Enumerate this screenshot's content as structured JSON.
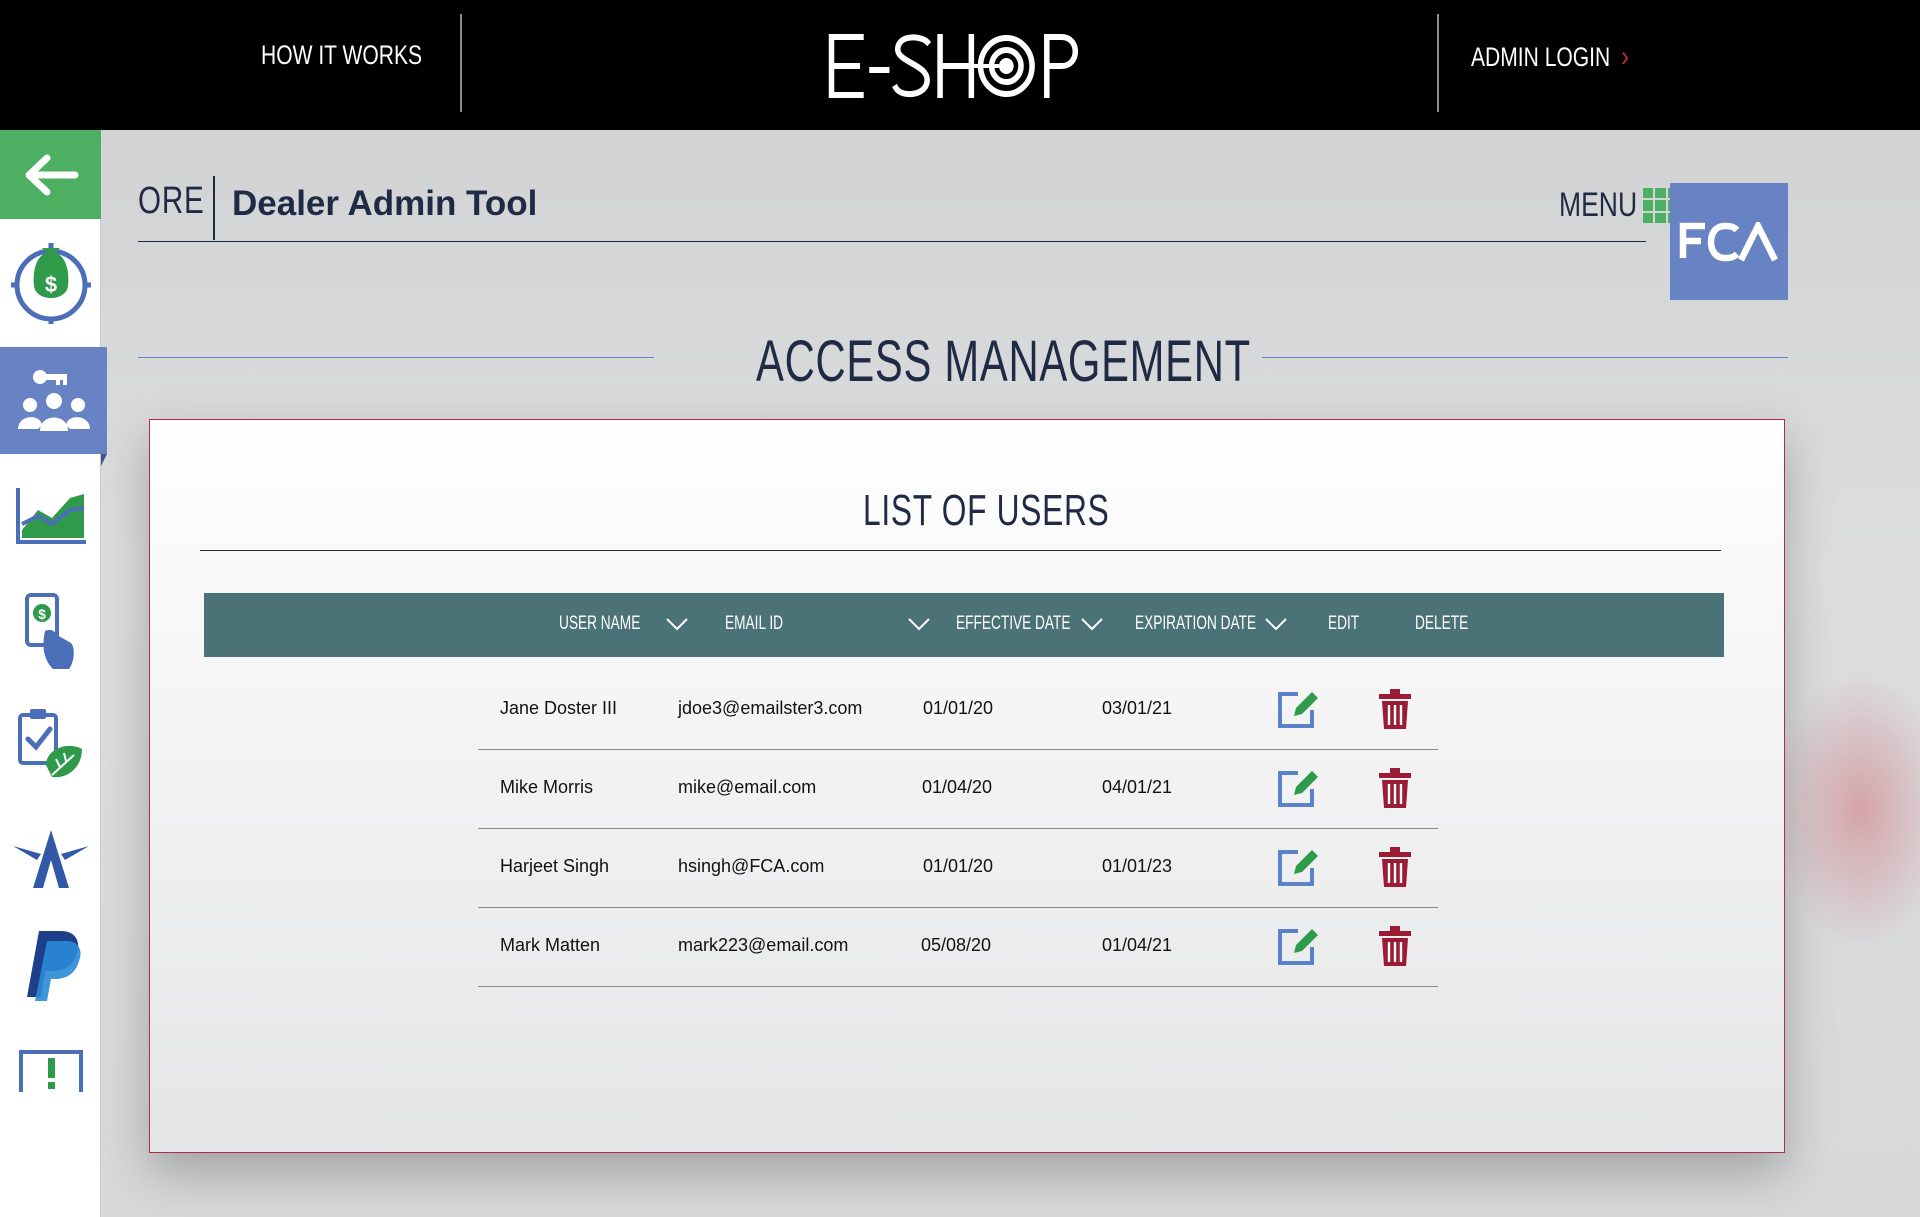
{
  "topbar": {
    "how_it_works": "HOW IT WORKS",
    "logo_text": "E-SHOP",
    "admin_login": "ADMIN LOGIN",
    "admin_chevron": "›"
  },
  "header": {
    "ore": "ORE",
    "title": "Dealer Admin Tool",
    "menu_label": "MENU",
    "brand_logo": "FCA"
  },
  "page_title": "ACCESS MANAGEMENT",
  "card": {
    "title": "LIST OF USERS",
    "columns": [
      "USER NAME",
      "EMAIL ID",
      "EFFECTIVE DATE",
      "EXPIRATION DATE",
      "EDIT",
      "DELETE"
    ],
    "rows": [
      {
        "name": "Jane Doster III",
        "email": "jdoe3@emailster3.com",
        "effective": "01/01/20",
        "expiration": "03/01/21"
      },
      {
        "name": "Mike Morris",
        "email": "mike@email.com",
        "effective": "01/04/20",
        "expiration": "04/01/21"
      },
      {
        "name": "Harjeet Singh",
        "email": "hsingh@FCA.com",
        "effective": "01/01/20",
        "expiration": "01/01/23"
      },
      {
        "name": "Mark Matten",
        "email": "mark223@email.com",
        "effective": "05/08/20",
        "expiration": "01/04/21"
      }
    ]
  },
  "sidebar": {
    "items": [
      "back-arrow-icon",
      "money-target-icon",
      "users-key-icon",
      "chart-icon",
      "mobile-payment-icon",
      "checklist-leaf-icon",
      "star-a-icon",
      "paypal-icon",
      "alert-icon"
    ]
  },
  "colors": {
    "green": "#4caf61",
    "blue": "#6783c4",
    "navy": "#1f2a44",
    "teal_header": "#4b7277",
    "delete_red": "#9b1b35"
  }
}
